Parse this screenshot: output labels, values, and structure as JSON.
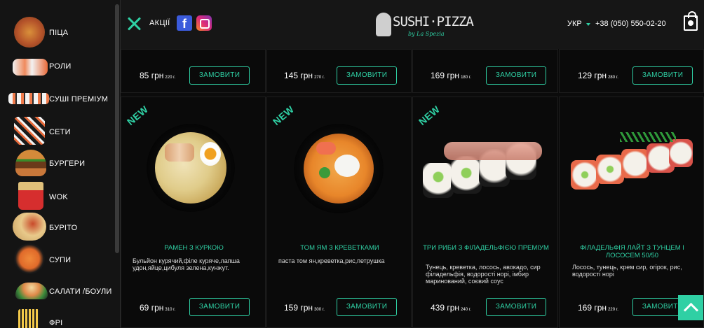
{
  "sidebar": {
    "items": [
      {
        "label": "ПІЦА",
        "icon": "pizza-icon"
      },
      {
        "label": "РОЛИ",
        "icon": "rolls-icon"
      },
      {
        "label": "СУШІ ПРЕМІУМ",
        "icon": "sushi-premium-icon"
      },
      {
        "label": "СЕТИ",
        "icon": "sets-icon"
      },
      {
        "label": "БУРГЕРИ",
        "icon": "burger-icon"
      },
      {
        "label": "WOK",
        "icon": "wok-icon"
      },
      {
        "label": "БУРІТО",
        "icon": "burrito-icon"
      },
      {
        "label": "СУПИ",
        "icon": "soup-icon"
      },
      {
        "label": "САЛАТИ /БОУЛИ",
        "icon": "salad-icon"
      },
      {
        "label": "ФРІ",
        "icon": "fries-icon"
      }
    ]
  },
  "header": {
    "promo_label": "АКЦІЇ",
    "facebook_glyph": "f",
    "logo_text": "SUSHI·PIZZA",
    "logo_sub": "by La Spezia",
    "lang": "УКР",
    "phone": "+38 (050) 550-02-20"
  },
  "top_row": [
    {
      "price": "85",
      "currency": "грн",
      "weight": "220 г.",
      "button": "ЗАМОВИТИ"
    },
    {
      "price": "145",
      "currency": "грн",
      "weight": "270 г.",
      "button": "ЗАМОВИТИ"
    },
    {
      "price": "169",
      "currency": "грн",
      "weight": "180 г.",
      "button": "ЗАМОВИТИ"
    },
    {
      "price": "129",
      "currency": "грн",
      "weight": "280 г.",
      "button": "ЗАМОВИТИ"
    }
  ],
  "products": [
    {
      "new": "NEW",
      "title": "РАМЕН З КУРКОЮ",
      "desc": "Бульйон курячий,філе куряче,лапша удон,яйце,цибуля зелена,кунжут.",
      "price": "69",
      "currency": "грн",
      "weight": "310 г.",
      "button": "ЗАМОВИТИ"
    },
    {
      "new": "NEW",
      "title": "ТОМ ЯМ З КРЕВЕТКАМИ",
      "desc": "паста том ян,креветка,рис,петрушка",
      "price": "159",
      "currency": "грн",
      "weight": "300 г.",
      "button": "ЗАМОВИТИ"
    },
    {
      "new": "NEW",
      "title": "ТРИ РИБИ З ФІЛАДЕЛЬФІЄЮ ПРЕМІУМ",
      "desc": "Тунець, креветка, лосось, авокадо, сир філадельфія, водорості норі, імбир маринований, соєвий соус",
      "price": "439",
      "currency": "грн",
      "weight": "240 г.",
      "button": "ЗАМОВИТИ"
    },
    {
      "new": "",
      "title": "ФІЛАДЕЛЬФІЯ ЛАЙТ З ТУНЦЕМ І ЛОСОСЕМ 50/50",
      "desc": "Лосось, тунець, крем сир, огірок, рис, водорості норі",
      "price": "169",
      "currency": "грн",
      "weight": "220 г.",
      "button": "ЗАМОВИТИ"
    }
  ],
  "colors": {
    "accent": "#2fd0a4",
    "background": "#0b0b0b",
    "sidebar": "#141414"
  }
}
